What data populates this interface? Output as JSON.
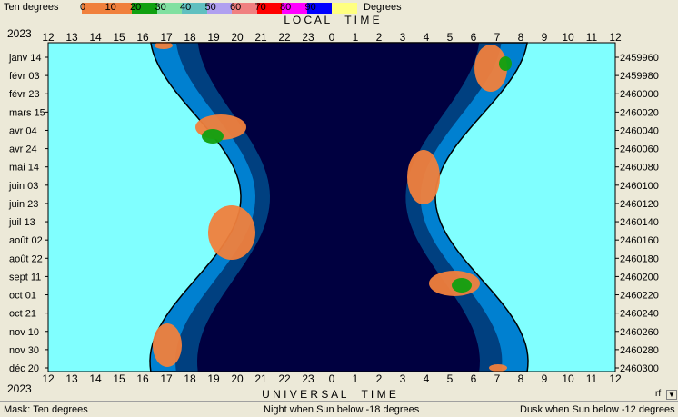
{
  "legend": {
    "left_label": "Ten degrees",
    "right_label": "Degrees",
    "segments": [
      {
        "label": "0",
        "color": "#f0803c"
      },
      {
        "label": "10",
        "color": "#f0803c"
      },
      {
        "label": "20",
        "color": "#10a010"
      },
      {
        "label": "30",
        "color": "#80e0a0"
      },
      {
        "label": "40",
        "color": "#60c0c0"
      },
      {
        "label": "50",
        "color": "#b0a0f0"
      },
      {
        "label": "60",
        "color": "#f08080"
      },
      {
        "label": "70",
        "color": "#ff0000"
      },
      {
        "label": "80",
        "color": "#ff00ff"
      },
      {
        "label": "90",
        "color": "#0000ff"
      },
      {
        "label": "",
        "color": "#ffff80"
      }
    ]
  },
  "chart": {
    "year_top": "2023",
    "year_bottom": "2023",
    "top_axis_title": "L O C A L     T I M E",
    "bottom_axis_title": "U N I V E R S A L     T I M E",
    "hour_ticks": [
      "12",
      "13",
      "14",
      "15",
      "16",
      "17",
      "18",
      "19",
      "20",
      "21",
      "22",
      "23",
      "0",
      "1",
      "2",
      "3",
      "4",
      "5",
      "6",
      "7",
      "8",
      "9",
      "10",
      "11",
      "12"
    ],
    "date_labels": [
      "janv 14",
      "févr 03",
      "févr 23",
      "mars 15",
      "avr 04",
      "avr 24",
      "mai 14",
      "juin 03",
      "juin 23",
      "juil 13",
      "août 02",
      "août 22",
      "sept 11",
      "oct 01",
      "oct 21",
      "nov 10",
      "nov 30",
      "déc 20"
    ],
    "jd_labels": [
      "2459960",
      "2459980",
      "2460000",
      "2460020",
      "2460040",
      "2460060",
      "2460080",
      "2460100",
      "2460120",
      "2460140",
      "2460160",
      "2460180",
      "2460200",
      "2460220",
      "2460240",
      "2460260",
      "2460280",
      "2460300"
    ],
    "colors": {
      "day": "#80ffff",
      "civil": "#0080d0",
      "nautical": "#004080",
      "night": "#000040",
      "ten_deg": "#f0803c",
      "twenty_deg": "#10a010"
    }
  },
  "status": {
    "mask": "Mask:  Ten degrees",
    "night": "Night when Sun below -18 degrees",
    "dusk": "Dusk when Sun below -12 degrees"
  },
  "rf": "rf"
}
